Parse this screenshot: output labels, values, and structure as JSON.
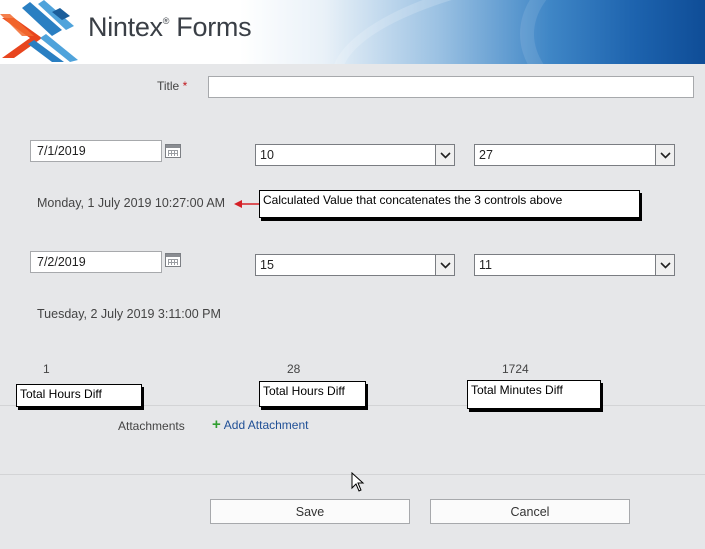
{
  "header": {
    "logo_text": "Nintex",
    "logo_reg": "®",
    "logo_suffix": " Forms"
  },
  "form": {
    "title_label": "Title",
    "required_marker": "*",
    "title_value": "",
    "row1": {
      "date": "7/1/2019",
      "hours": "10",
      "minutes": "27"
    },
    "calc1": "Monday, 1 July 2019 10:27:00 AM",
    "annotation1": "Calculated Value that concatenates the 3 controls above",
    "row2": {
      "date": "7/2/2019",
      "hours": "15",
      "minutes": "11"
    },
    "calc2": "Tuesday, 2 July 2019 3:11:00 PM",
    "diffs": [
      {
        "value": "1",
        "annotation": "Total Hours Diff"
      },
      {
        "value": "28",
        "annotation": "Total Hours Diff"
      },
      {
        "value": "1724",
        "annotation": "Total Minutes Diff"
      }
    ],
    "attachments_label": "Attachments",
    "add_attachment": "Add Attachment",
    "save_label": "Save",
    "cancel_label": "Cancel"
  },
  "colors": {
    "background": "#e6e7e9",
    "required": "#c0171c",
    "link": "#1f4f96",
    "arrow": "#d52027",
    "plus": "#2f9e2f"
  },
  "icons": [
    "nintex-logo-icon",
    "calendar-icon",
    "dropdown-arrow-icon",
    "red-arrow-icon",
    "plus-icon",
    "mouse-cursor-icon"
  ]
}
